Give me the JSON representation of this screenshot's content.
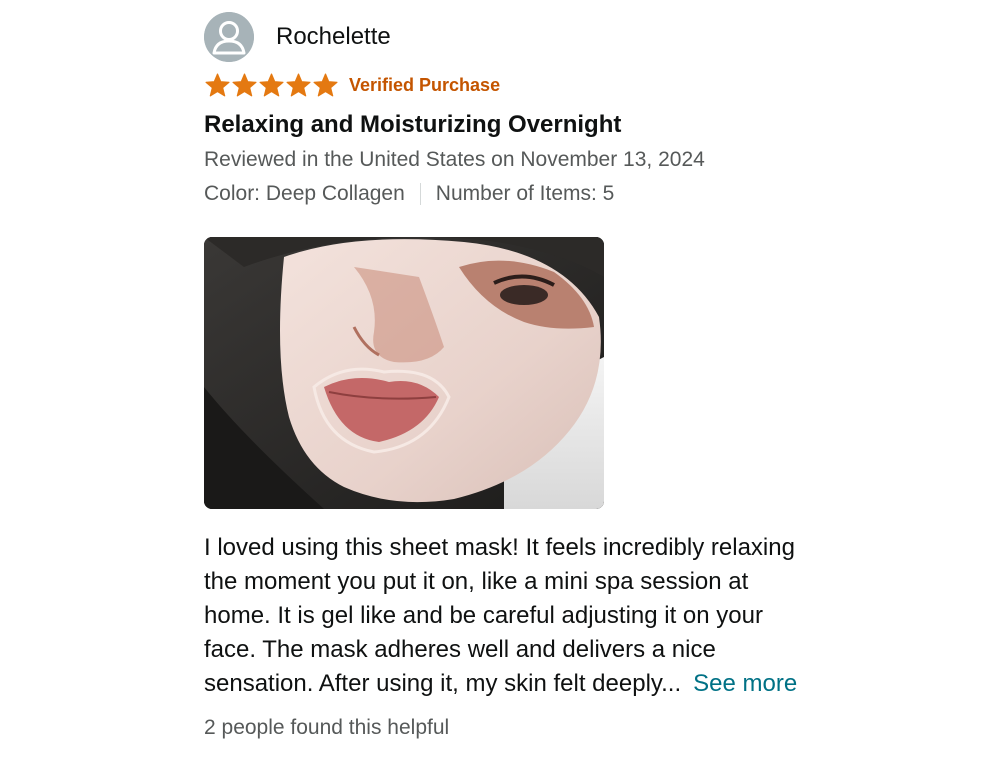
{
  "review": {
    "reviewer_name": "Rochelette",
    "rating": 5,
    "rating_max": 5,
    "verified_label": "Verified Purchase",
    "title": "Relaxing and Moisturizing Overnight",
    "date_text": "Reviewed in the United States on November 13, 2024",
    "color_text": "Color: Deep Collagen",
    "items_text": "Number of Items: 5",
    "body_text": "I loved using this sheet mask! It feels incredibly relaxing the moment you put it on, like a mini spa session at home. It is gel like and be careful adjusting it on your face. The mask adheres well and delivers a nice sensation. After using it, my skin felt deeply...",
    "see_more_label": "See more",
    "helpful_text": "2 people found this helpful"
  },
  "icons": {
    "avatar": "default-user-avatar-icon",
    "star": "star-icon"
  },
  "colors": {
    "star": "#e47911",
    "verified": "#c45500",
    "link": "#007185",
    "secondary_text": "#565959",
    "avatar_bg": "#a7b3b8"
  }
}
